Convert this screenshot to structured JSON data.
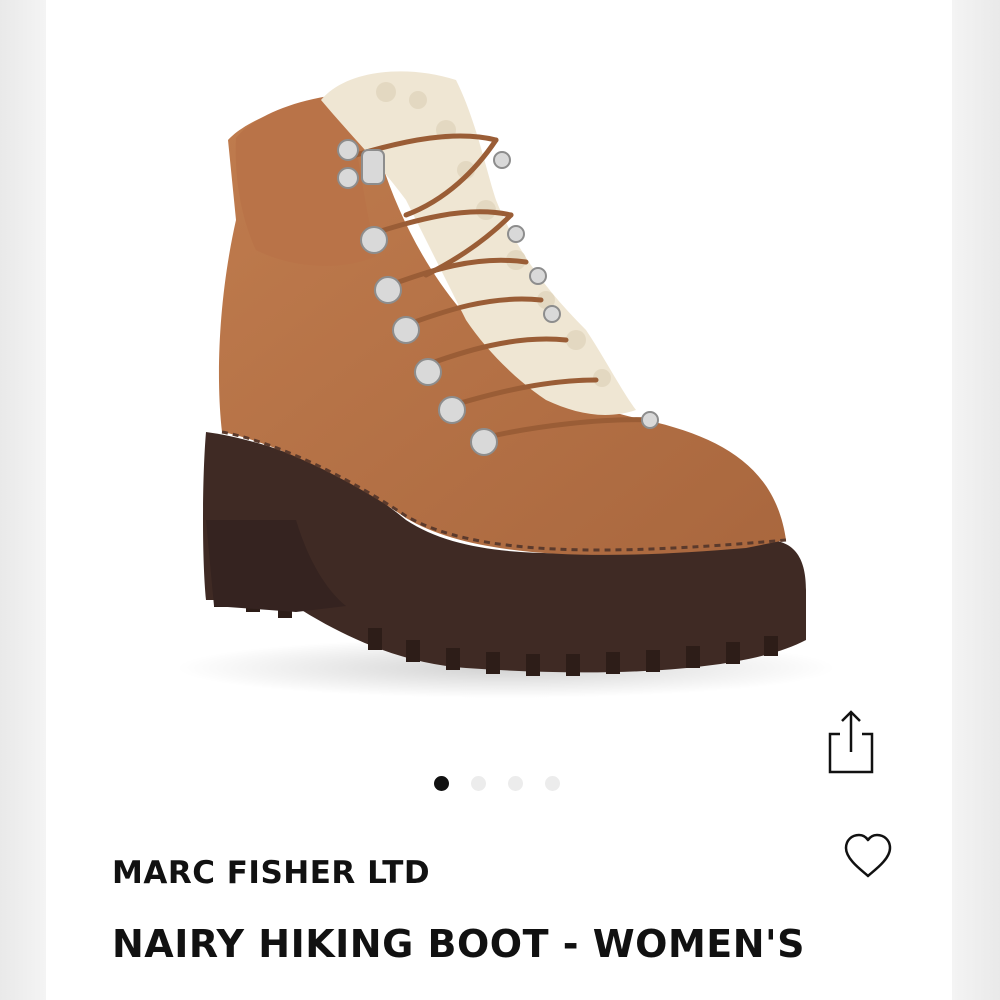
{
  "product": {
    "brand": "MARC FISHER LTD",
    "title": "NAIRY HIKING BOOT - WOMEN'S",
    "image_icon": "hiking-boot-image"
  },
  "carousel": {
    "total_images": 4,
    "active_index": 0
  },
  "actions": {
    "share_icon": "share-icon",
    "wishlist_icon": "heart-icon"
  },
  "colors": {
    "suede": "#b8754a",
    "sole": "#3f2a24",
    "shearling": "#efe6d3",
    "text": "#111111",
    "dot_active": "#111111",
    "dot_inactive": "#ececec"
  }
}
